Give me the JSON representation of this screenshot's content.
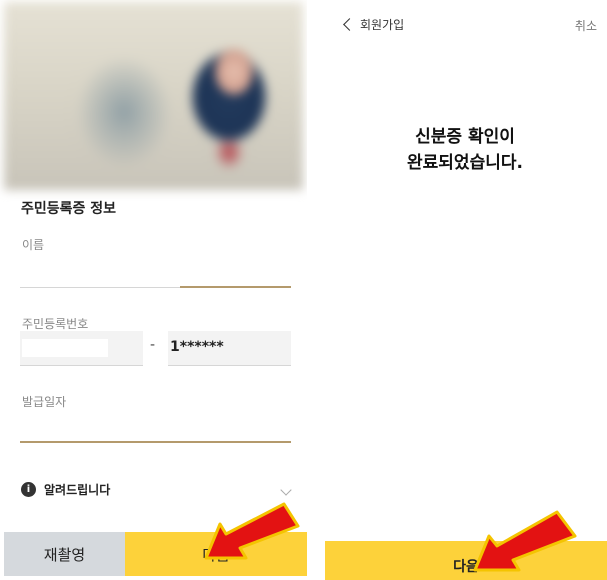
{
  "left": {
    "section_title": "주민등록증 정보",
    "name_label": "이름",
    "name_value": "",
    "rrn_label": "주민등록번호",
    "rrn_front": "",
    "rrn_separator": "-",
    "rrn_back": "1******",
    "issue_date_label": "발급일자",
    "issue_date_value": "",
    "notice_label": "알려드립니다",
    "retake_button": "재촬영",
    "next_button": "다음"
  },
  "right": {
    "header_title": "회원가입",
    "cancel_label": "취소",
    "message_line1": "신분증 확인이",
    "message_line2": "완료되었습니다.",
    "next_button": "다음"
  },
  "colors": {
    "accent_yellow": "#fdd23a",
    "secondary_button": "#d5d9dd",
    "arrow_red": "#e31212",
    "arrow_outline": "#f4c400"
  }
}
